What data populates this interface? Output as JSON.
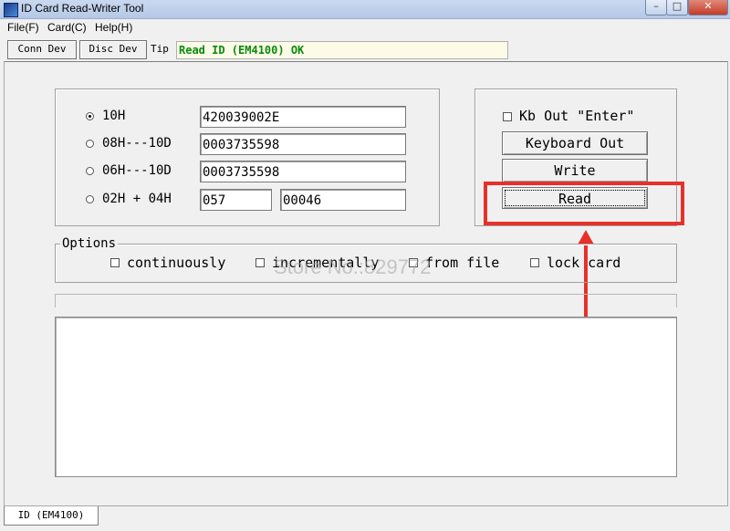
{
  "window": {
    "title": "ID Card Read-Writer Tool",
    "minimize": "–",
    "maximize": "□",
    "close": "✕"
  },
  "menu": {
    "file": "File(F)",
    "card": "Card(C)",
    "help": "Help(H)"
  },
  "toolbar": {
    "conn": "Conn Dev",
    "disc": "Disc Dev",
    "tip_label": "Tip",
    "tip_value": "Read ID (EM4100) OK"
  },
  "id_formats": {
    "opt_10h": {
      "label": "10H",
      "value": "420039002E",
      "selected": true
    },
    "opt_08h": {
      "label": "08H---10D",
      "value": "0003735598"
    },
    "opt_06h": {
      "label": "06H---10D",
      "value": "0003735598"
    },
    "opt_02h": {
      "label": "02H + 04H",
      "value_a": "057",
      "value_b": "00046"
    }
  },
  "keyboard": {
    "kb_out_label": "Kb Out \"Enter\"",
    "keyboard_out": "Keyboard Out",
    "write": "Write",
    "read": "Read"
  },
  "options": {
    "legend": "Options",
    "continuously": "continuously",
    "incrementally": "incrementally",
    "from_file": "from file",
    "lock_card": "lock card"
  },
  "watermark": "Store No.:829772",
  "bottom_tab": "ID (EM4100)",
  "colors": {
    "highlight": "#e8302a",
    "tip_text": "#0a8a0a"
  }
}
